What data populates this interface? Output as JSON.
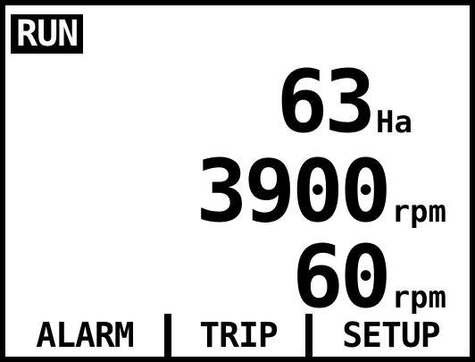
{
  "display": {
    "mode": "RUN",
    "readings": [
      {
        "value": "63",
        "unit": "Ha"
      },
      {
        "value": "3900",
        "unit": "rpm"
      },
      {
        "value": "60",
        "unit": "rpm"
      }
    ],
    "softkeys": [
      "ALARM",
      "TRIP",
      "SETUP"
    ],
    "colors": {
      "background": "#ffffff",
      "foreground": "#000000",
      "bezel": "#000000"
    }
  }
}
